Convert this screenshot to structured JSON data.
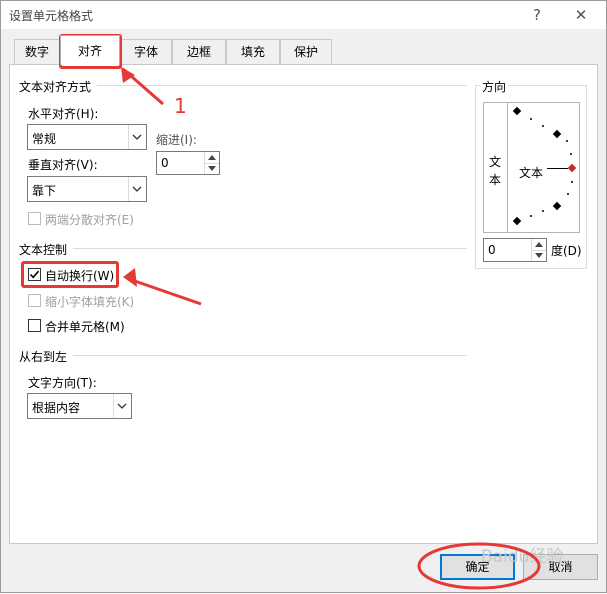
{
  "window": {
    "title": "设置单元格格式",
    "help_label": "?",
    "close_label": "✕"
  },
  "tabs": [
    {
      "label": "数字",
      "active": false
    },
    {
      "label": "对齐",
      "active": true
    },
    {
      "label": "字体",
      "active": false
    },
    {
      "label": "边框",
      "active": false
    },
    {
      "label": "填充",
      "active": false
    },
    {
      "label": "保护",
      "active": false
    }
  ],
  "text_alignment": {
    "group_title": "文本对齐方式",
    "horizontal_label": "水平对齐(H):",
    "horizontal_value": "常规",
    "indent_label": "缩进(I):",
    "indent_value": "0",
    "vertical_label": "垂直对齐(V):",
    "vertical_value": "靠下",
    "justify_distributed_label": "两端分散对齐(E)"
  },
  "text_control": {
    "group_title": "文本控制",
    "wrap_text_label": "自动换行(W)",
    "wrap_text_checked": true,
    "shrink_to_fit_label": "缩小字体填充(K)",
    "merge_cells_label": "合并单元格(M)"
  },
  "right_to_left": {
    "group_title": "从右到左",
    "direction_label": "文字方向(T):",
    "direction_value": "根据内容"
  },
  "orientation": {
    "group_title": "方向",
    "vertical_text": [
      "文",
      "本"
    ],
    "dial_text": "文本",
    "degrees_value": "0",
    "degrees_label": "度(D)"
  },
  "buttons": {
    "ok_label": "确定",
    "cancel_label": "取消"
  },
  "annotations": {
    "step_number": "1"
  },
  "watermark": {
    "text": "Baidu经验"
  },
  "colors": {
    "annotation_red": "#e53935",
    "default_button_border": "#0078d7"
  }
}
